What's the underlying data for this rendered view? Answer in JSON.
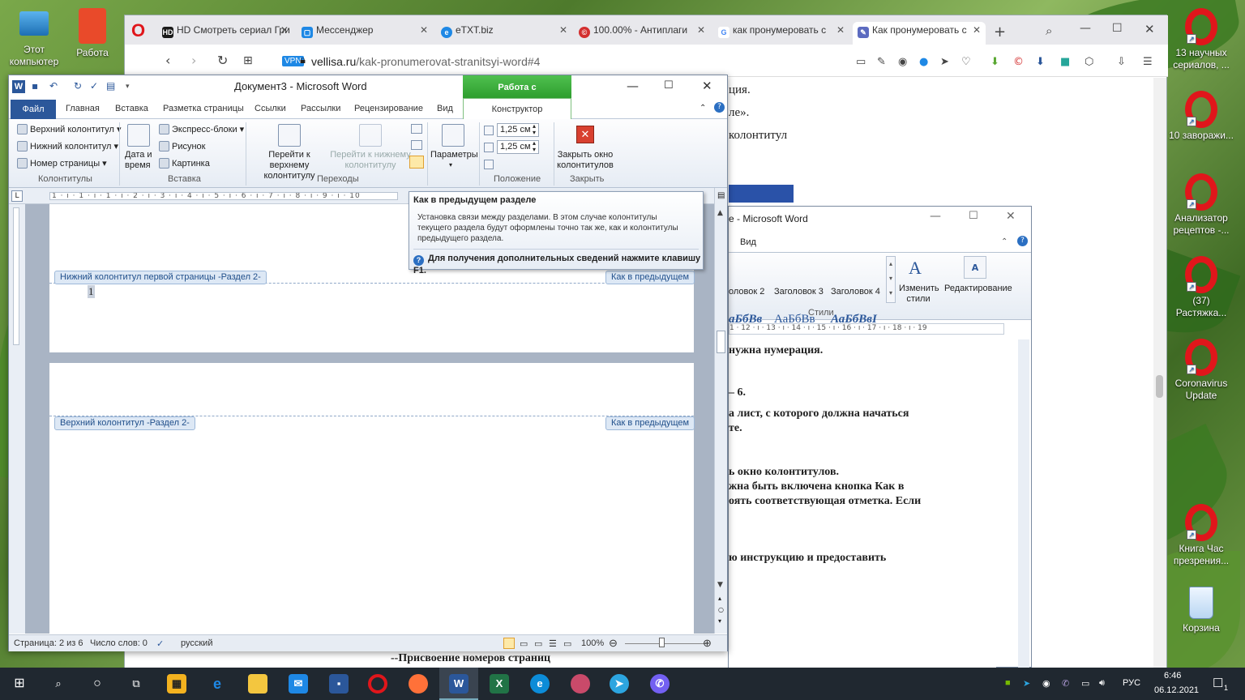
{
  "desktop": {
    "left_icons": [
      {
        "label": "Этот компьютер",
        "icon": "computer-icon"
      },
      {
        "label": "Работа",
        "icon": "folder-icon"
      }
    ],
    "right_icons": [
      {
        "label": "13 научных сериалов, ...",
        "icon": "opera-icon"
      },
      {
        "label": "10 заворажи...",
        "icon": "opera-icon"
      },
      {
        "label": "Анализатор рецептов -...",
        "icon": "opera-icon"
      },
      {
        "label": "(37) Растяжка...",
        "icon": "opera-icon"
      },
      {
        "label": "Coronavirus Update",
        "icon": "opera-icon"
      },
      {
        "label": "Книга Час презрения...",
        "icon": "opera-icon"
      },
      {
        "label": "Корзина",
        "icon": "recycle-bin-icon"
      }
    ]
  },
  "browser": {
    "tabs": [
      {
        "label": "HD Смотреть сериал Гри",
        "icon": "hd-icon",
        "color": "#1a1a1a"
      },
      {
        "label": "Мессенджер",
        "icon": "messenger-icon",
        "color": "#1e88e5"
      },
      {
        "label": "eTXT.biz",
        "icon": "etxt-icon",
        "color": "#1e88e5"
      },
      {
        "label": "100.00% - Антиплаги",
        "icon": "copyright-icon",
        "color": "#d32f2f"
      },
      {
        "label": "как пронумеровать с",
        "icon": "google-icon",
        "color": "#4285f4"
      },
      {
        "label": "Как пронумеровать с",
        "icon": "site-icon",
        "color": "#5c6bc0",
        "active": true
      }
    ],
    "vpn_label": "VPN",
    "url_domain": "vellisa.ru",
    "url_path": "/kak-pronumerovat-stranitsyi-word#4",
    "article_lines": [
      "ция.",
      "ле».",
      "колонтитул",
      "нужна нумерация.",
      "– 6.",
      "а лист, с которого должна начаться",
      "те.",
      "ь окно колонтитулов.",
      "жна быть включена кнопка Как в",
      "оять соответствующая отметка. Если",
      "ю инструкцию и предоставить",
      "--Присвоение номеров страниц"
    ]
  },
  "word1": {
    "title": "Документ3 - Microsoft Word",
    "context_tab": "Работа с колонтитулами",
    "tabs": [
      "Файл",
      "Главная",
      "Вставка",
      "Разметка страницы",
      "Ссылки",
      "Рассылки",
      "Рецензирование",
      "Вид"
    ],
    "constructor_tab": "Конструктор",
    "ribbon": {
      "header": "Верхний колонтитул",
      "footer": "Нижний колонтитул",
      "page_number": "Номер страницы",
      "group_hf": "Колонтитулы",
      "date_time": "Дата и время",
      "express": "Экспресс-блоки",
      "picture": "Рисунок",
      "clipart": "Картинка",
      "group_insert": "Вставка",
      "goto_header": "Перейти к верхнему колонтитулу",
      "goto_footer": "Перейти к нижнему колонтитулу",
      "group_nav": "Переходы",
      "params": "Параметры",
      "spin1": "1,25 см",
      "spin2": "1,25 см",
      "group_pos": "Положение",
      "close": "Закрыть окно колонтитулов",
      "group_close": "Закрыть"
    },
    "ruler_text": "1 · ı · 1 · ı · 1 · ı · 2 · ı · 3 · ı · 4 · ı · 5 · ı · 6 · ı · 7 · ı · 8 · ı · 9 · ı · 10",
    "footer_label": "Нижний колонтитул первой страницы -Раздел 2-",
    "link_prev": "Как в предыдущем",
    "page_num": "1",
    "header_label": "Верхний колонтитул -Раздел 2-",
    "status": {
      "page": "Страница: 2 из 6",
      "words": "Число слов: 0",
      "lang": "русский",
      "zoom": "100%"
    }
  },
  "tooltip": {
    "title": "Как в предыдущем разделе",
    "body": "Установка связи между разделами. В этом случае колонтитулы текущего раздела будут оформлены точно так же, как и колонтитулы предыдущего раздела.",
    "footer": "Для получения дополнительных сведений нажмите клавишу F1."
  },
  "word2": {
    "title": "е - Microsoft Word",
    "tab_view": "Вид",
    "styles": [
      {
        "sample": "аБбВв",
        "name": "оловок 2"
      },
      {
        "sample": "АаБбВв",
        "name": "Заголовок 3"
      },
      {
        "sample": "АаБбВвI",
        "name": "Заголовок 4"
      }
    ],
    "change_styles": "Изменить стили",
    "editing": "Редактирование",
    "group_styles": "Стили",
    "ruler_text": "1 · 12 · ı · 13 · ı · 14 · ı · 15 · ı · 16 · ı · 17 · ı · 18 · ı · 19"
  },
  "taskbar": {
    "lang": "РУС",
    "time": "6:46",
    "date": "06.12.2021",
    "notif_count": "1"
  }
}
